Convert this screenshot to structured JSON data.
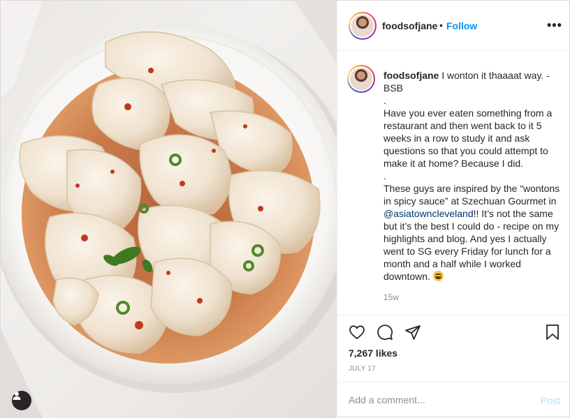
{
  "post": {
    "username": "foodsofjane",
    "follow_label": "Follow",
    "separator": "•",
    "more_label": "•••",
    "photo_description_icon": "user-tag-icon"
  },
  "caption": {
    "username": "foodsofjane",
    "line1": " I wonton it thaaaat way. - BSB\n.\nHave you ever eaten something from a restaurant and then went back to it 5 weeks in a row to study it and ask questions so that you could attempt to make it at home? Because I did.\n.\nThese guys are inspired by the “wontons in spicy sauce” at Szechuan Gourmet in ",
    "mention": "@asiatowncleveland",
    "line2": "!! It’s not the same but it’s the best I could do - recipe on my highlights and blog. And yes I actually went to SG every Friday for lunch for a month and a half while I worked downtown. ",
    "emoji": "grinning-sweat-emoji",
    "time_ago": "15w"
  },
  "actions": {
    "icons": [
      "heart-icon",
      "comment-icon",
      "share-icon",
      "bookmark-icon"
    ],
    "likes": "7,267 likes",
    "date": "JULY 17"
  },
  "comment": {
    "placeholder": "Add a comment...",
    "post_label": "Post"
  },
  "colors": {
    "accent": "#0095f6",
    "post_disabled": "#b2dffc",
    "text": "#262626",
    "muted": "#8e8e8e"
  }
}
